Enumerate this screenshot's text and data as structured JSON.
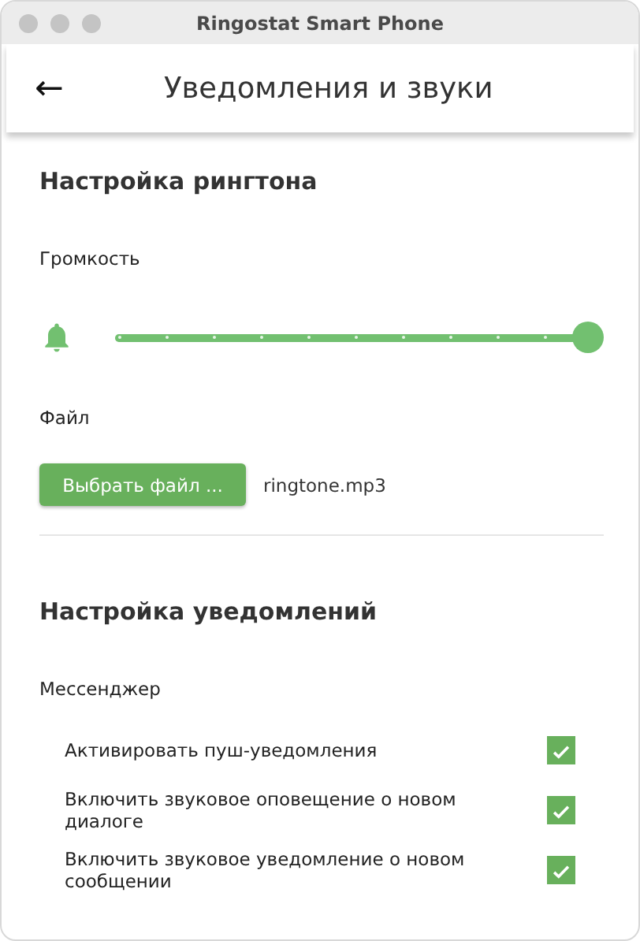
{
  "window": {
    "title": "Ringostat Smart Phone"
  },
  "header": {
    "back": "←",
    "title": "Уведомления и звуки"
  },
  "ringtone": {
    "title": "Настройка рингтона",
    "volume_label": "Громкость",
    "volume": {
      "level": 1
    },
    "file_label": "Файл",
    "choose_button": "Выбрать файл ...",
    "file_name": "ringtone.mp3"
  },
  "notifications": {
    "title": "Настройка уведомлений",
    "group": "Мессенджер",
    "options": [
      {
        "label": "Активировать пуш-уведомления",
        "checked": true
      },
      {
        "label": "Включить звуковое оповещение о новом диалоге",
        "checked": true
      },
      {
        "label": "Включить звуковое уведомление о новом сообщении",
        "checked": true
      }
    ]
  }
}
